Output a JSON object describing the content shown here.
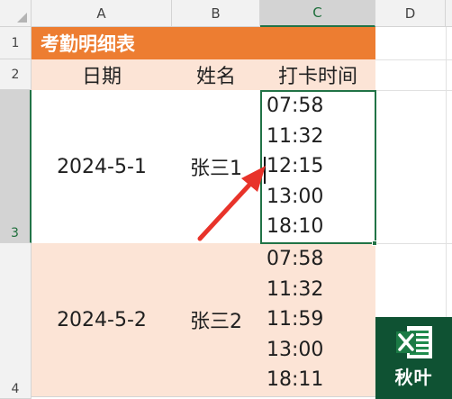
{
  "column_headers": [
    "A",
    "B",
    "C",
    "D"
  ],
  "row_headers": [
    "1",
    "2",
    "3",
    "4"
  ],
  "title": "考勤明细表",
  "table_header": {
    "date": "日期",
    "name": "姓名",
    "punch_times": "打卡时间"
  },
  "rows": [
    {
      "date": "2024-5-1",
      "name": "张三1",
      "times": [
        "07:58",
        "11:32",
        "12:15",
        "13:00",
        "18:10"
      ]
    },
    {
      "date": "2024-5-2",
      "name": "张三2",
      "times": [
        "07:58",
        "11:32",
        "11:59",
        "13:00",
        "18:11"
      ]
    }
  ],
  "selected_cell": "C3",
  "colors": {
    "title_bg": "#ed7d31",
    "header_bg": "#fce4d6",
    "selection": "#217346",
    "arrow": "#e8332a",
    "logo_bg": "#0f5233"
  },
  "logo": {
    "text": "秋叶",
    "icon": "excel-x-icon"
  }
}
